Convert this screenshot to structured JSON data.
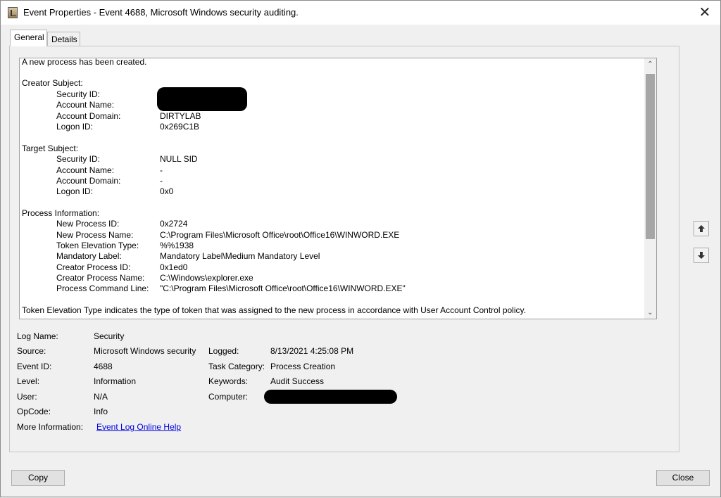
{
  "window": {
    "title": "Event Properties - Event 4688, Microsoft Windows security auditing.",
    "close_glyph": "✕"
  },
  "tabs": [
    {
      "label": "General"
    },
    {
      "label": "Details"
    }
  ],
  "message": {
    "intro": "A new process has been created.",
    "creator_heading": "Creator Subject:",
    "creator": [
      {
        "key": "Security ID:",
        "value": ""
      },
      {
        "key": "Account Name:",
        "value": ""
      },
      {
        "key": "Account Domain:",
        "value": "DIRTYLAB"
      },
      {
        "key": "Logon ID:",
        "value": "0x269C1B"
      }
    ],
    "target_heading": "Target Subject:",
    "target": [
      {
        "key": "Security ID:",
        "value": "NULL SID"
      },
      {
        "key": "Account Name:",
        "value": "-"
      },
      {
        "key": "Account Domain:",
        "value": "-"
      },
      {
        "key": "Logon ID:",
        "value": "0x0"
      }
    ],
    "process_heading": "Process Information:",
    "process": [
      {
        "key": "New Process ID:",
        "value": "0x2724"
      },
      {
        "key": "New Process Name:",
        "value": "C:\\Program Files\\Microsoft Office\\root\\Office16\\WINWORD.EXE"
      },
      {
        "key": "Token Elevation Type:",
        "value": "%%1938"
      },
      {
        "key": "Mandatory Label:",
        "value": "Mandatory Label\\Medium Mandatory Level"
      },
      {
        "key": "Creator Process ID:",
        "value": "0x1ed0"
      },
      {
        "key": "Creator Process Name:",
        "value": "C:\\Windows\\explorer.exe"
      },
      {
        "key": "Process Command Line:",
        "value": "\"C:\\Program Files\\Microsoft Office\\root\\Office16\\WINWORD.EXE\""
      }
    ],
    "footer": "Token Elevation Type indicates the type of token that was assigned to the new process in accordance with User Account Control policy.",
    "scroll_up_glyph": "⌃",
    "scroll_down_glyph": "⌄"
  },
  "details": {
    "log_name_label": "Log Name:",
    "log_name": "Security",
    "source_label": "Source:",
    "source": "Microsoft Windows security",
    "logged_label": "Logged:",
    "logged": "8/13/2021 4:25:08 PM",
    "event_id_label": "Event ID:",
    "event_id": "4688",
    "task_category_label": "Task Category:",
    "task_category": "Process Creation",
    "level_label": "Level:",
    "level": "Information",
    "keywords_label": "Keywords:",
    "keywords": "Audit Success",
    "user_label": "User:",
    "user": "N/A",
    "computer_label": "Computer:",
    "computer": "",
    "opcode_label": "OpCode:",
    "opcode": "Info",
    "more_info_label": "More Information:",
    "more_info_link": "Event Log Online Help"
  },
  "buttons": {
    "copy": "Copy",
    "close": "Close"
  },
  "colors": {
    "link": "#0000e0",
    "redaction": "#000000"
  }
}
